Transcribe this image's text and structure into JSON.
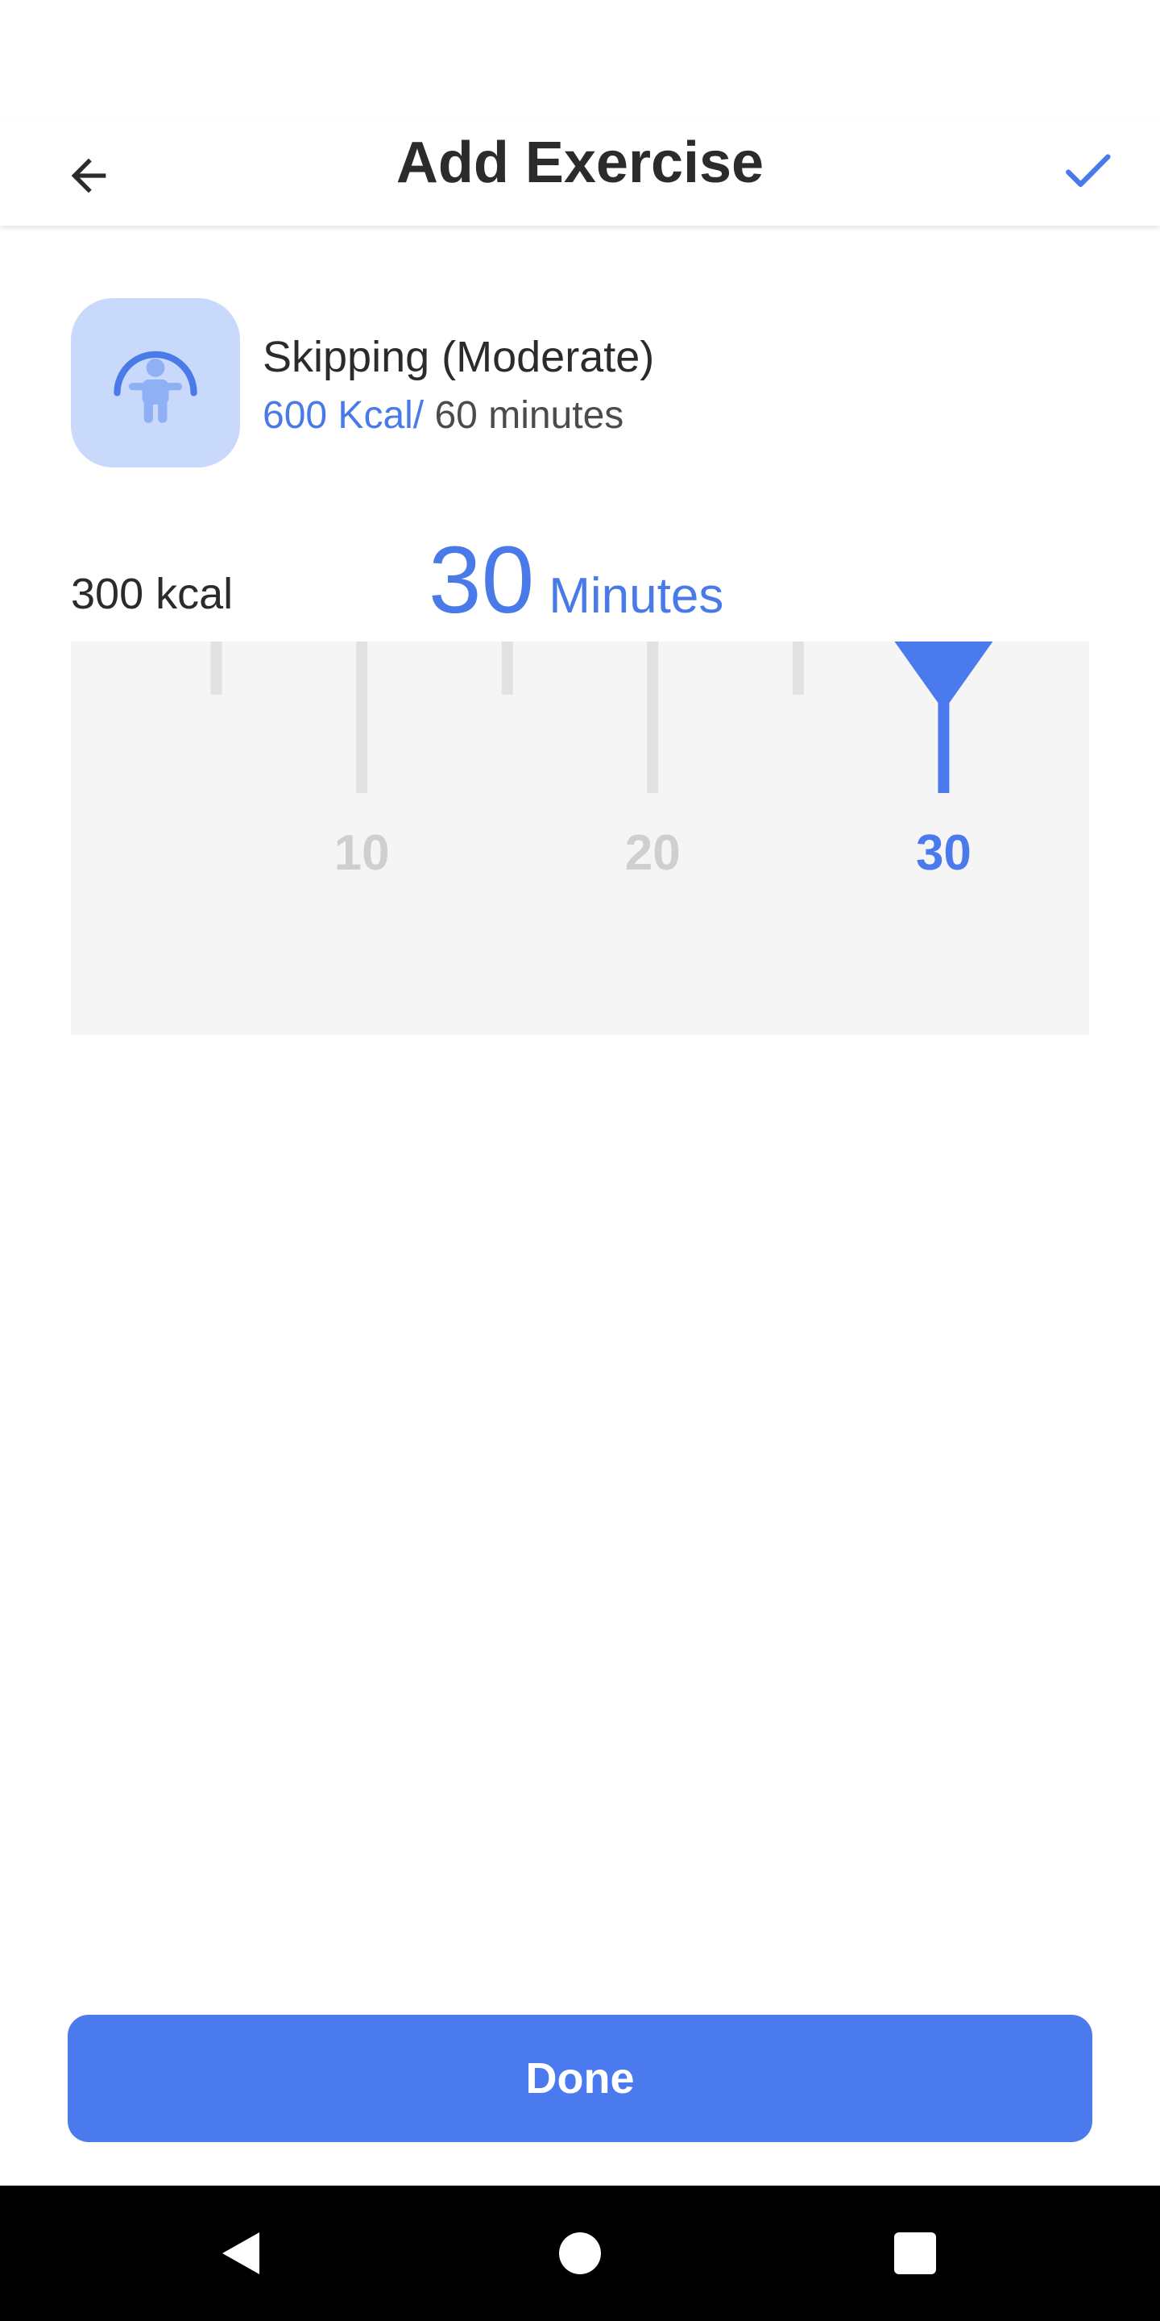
{
  "app_bar": {
    "title": "Add Exercise",
    "back_icon": "arrow-left-icon",
    "confirm_icon": "check-icon"
  },
  "exercise": {
    "name": "Skipping (Moderate)",
    "rate_kcal": "600 Kcal/",
    "rate_minutes": " 60 minutes",
    "icon": "jump-rope-person-icon"
  },
  "readout": {
    "calories": "300 kcal",
    "duration_value": "30",
    "duration_unit": "Minutes"
  },
  "ruler": {
    "labels": [
      "10",
      "20",
      "30"
    ],
    "min_visible": 0,
    "max_visible": 35,
    "selected": 30,
    "major_step": 10,
    "minor_step": 5
  },
  "done_label": "Done",
  "nav": {
    "back_icon": "triangle-back-icon",
    "home_icon": "circle-home-icon",
    "recents_icon": "square-recents-icon"
  },
  "colors": {
    "accent": "#4a7aee",
    "accent_text": "#4a7ae8",
    "icon_tile": "#c9d9fc",
    "ruler_bg": "#f5f5f5",
    "tick": "#e2e2e2",
    "tick_label": "#cfcfcf",
    "text": "#2b2b2b"
  }
}
